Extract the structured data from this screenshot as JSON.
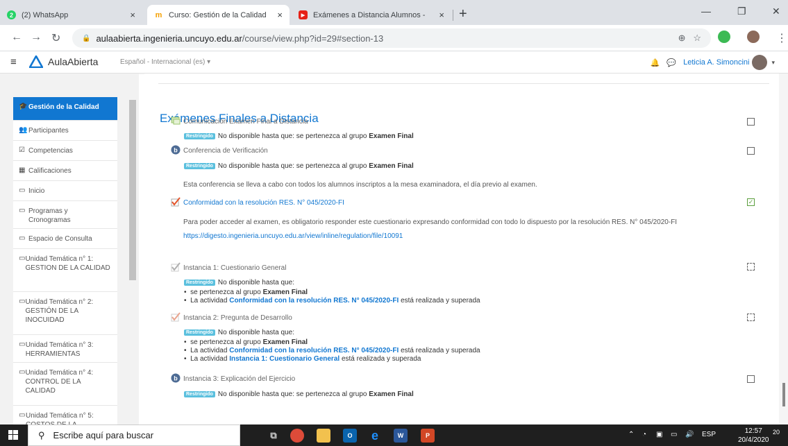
{
  "browser": {
    "tabs": [
      {
        "title": "(2) WhatsApp",
        "badge": "2",
        "color": "#25d366"
      },
      {
        "title": "Curso: Gestión de la Calidad",
        "color": "#f5a000"
      },
      {
        "title": "Exámenes a Distancia Alumnos -",
        "color": "#e62117"
      }
    ],
    "close_glyph": "×",
    "newtab_glyph": "+",
    "url_domain": "aulaabierta.ingenieria.uncuyo.edu.ar",
    "url_path": "/course/view.php?id=29#section-13"
  },
  "moodle": {
    "brand": "AulaAbierta",
    "language": "Español - Internacional (es) ▾",
    "user": "Leticia A. Simoncini"
  },
  "drawer": {
    "items": [
      {
        "icon": "graduation-cap-icon",
        "glyph": "🎓",
        "label": "Gestión de la Calidad",
        "active": true
      },
      {
        "icon": "users-icon",
        "glyph": "👥",
        "label": "Participantes"
      },
      {
        "icon": "checkbox-icon",
        "glyph": "☑",
        "label": "Competencias"
      },
      {
        "icon": "table-icon",
        "glyph": "▦",
        "label": "Calificaciones"
      },
      {
        "icon": "folder-icon",
        "glyph": "▭",
        "label": "Inicio"
      },
      {
        "icon": "folder-icon",
        "glyph": "▭",
        "label": "Programas y Cronogramas"
      },
      {
        "icon": "folder-icon",
        "glyph": "▭",
        "label": "Espacio de Consulta"
      },
      {
        "icon": "folder-icon",
        "glyph": "▭",
        "label": "Unidad Temática n° 1: GESTION DE LA CALIDAD"
      },
      {
        "icon": "folder-icon",
        "glyph": "▭",
        "label": "Unidad Temática n° 2: GESTIÓN DE LA INOCUIDAD"
      },
      {
        "icon": "folder-icon",
        "glyph": "▭",
        "label": "Unidad Temática n° 3: HERRAMIENTAS"
      },
      {
        "icon": "folder-icon",
        "glyph": "▭",
        "label": "Unidad Temática n° 4: CONTROL DE LA CALIDAD"
      },
      {
        "icon": "folder-icon",
        "glyph": "▭",
        "label": "Unidad Temática n° 5: COSTOS DE LA"
      }
    ]
  },
  "section": {
    "title": "Exámenes Finales a Distancia",
    "restricted_label": "Restringido",
    "not_available_prefix": "No disponible hasta que: se pertenezca al grupo",
    "not_available_short": "No disponible hasta que:",
    "group_prefix": "se pertenezca al grupo",
    "group_name": "Examen Final",
    "activity_prefix": "La actividad",
    "activity_suffix": "está realizada y superada",
    "activities": [
      {
        "title": "Comunicación Examen Final a Distancia"
      },
      {
        "title": "Conferencia de Verificación",
        "description": "Esta conferencia se lleva a cabo con todos los alumnos inscriptos a la mesa examinadora, el día previo al examen."
      },
      {
        "title": "Conformidad con la resolución RES. N° 045/2020-FI",
        "description": "Para poder acceder al examen, es obligatorio responder este cuestionario expresando conformidad con todo lo dispuesto por la resolución RES. N° 045/2020-FI",
        "link": "https://digesto.ingenieria.uncuyo.edu.ar/view/inline/regulation/file/10091"
      },
      {
        "title": "Instancia 1: Cuestionario General",
        "req1": "Conformidad con la resolución RES. N° 045/2020-FI"
      },
      {
        "title": "Instancia 2: Pregunta de Desarrollo",
        "req1": "Conformidad con la resolución RES. N° 045/2020-FI",
        "req2": "Instancia 1: Cuestionario General"
      },
      {
        "title": "Instancia 3: Explicación del Ejercicio"
      }
    ]
  },
  "taskbar": {
    "search_placeholder": "Escribe aquí para buscar",
    "language": "ESP",
    "time": "12:57",
    "date": "20/4/2020",
    "notifications": "20"
  }
}
